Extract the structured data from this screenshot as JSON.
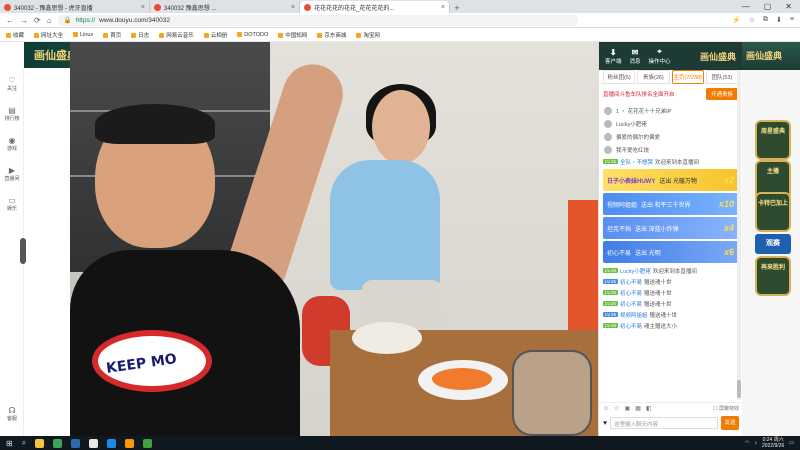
{
  "browser": {
    "tabs": [
      {
        "title": "340032 - 豫鑫思想 - 虎牙直播"
      },
      {
        "title": "340032 豫鑫思想 ..."
      },
      {
        "title": "花花花花的花花_花花花花的..."
      }
    ],
    "url_scheme": "https://",
    "url_host": "www.douyu.com/340032",
    "bookmarks": [
      "收藏",
      "网址大全",
      "Linux",
      "首页",
      "日志",
      "网易云音乐",
      "云相册",
      "DOTODO",
      "中国知网",
      "京东商城",
      "淘宝网"
    ]
  },
  "left_rail": {
    "items": [
      {
        "label": "关注",
        "icon": "heart-icon"
      },
      {
        "label": "排行榜",
        "icon": "chart-icon"
      },
      {
        "label": "游戏",
        "icon": "game-icon"
      },
      {
        "label": "直播间",
        "icon": "live-icon"
      },
      {
        "label": "娱乐",
        "icon": "tv-icon"
      },
      {
        "label": "客服",
        "icon": "headset-icon"
      }
    ]
  },
  "stream_header": {
    "logo": "画仙盛典",
    "right_items": [
      {
        "label": "客户端",
        "icon": "download-icon"
      },
      {
        "label": "消息",
        "icon": "bell-icon"
      },
      {
        "label": "操作中心",
        "icon": "pin-icon"
      }
    ],
    "right_logo": "画仙盛典"
  },
  "video": {
    "shirt_text": "KEEP MO"
  },
  "chat": {
    "tabs": [
      "粉丝团(5)",
      "贵族(26)",
      "主页(7/238)",
      "团队(53)"
    ],
    "active_tab": 2,
    "notice_text": "直播间斗鱼车队排名全面开启",
    "notice_button": "开通贵族",
    "rank": [
      "1 ・ 花花花十十兄弟IP",
      "Lucky小肥佬",
      "偏爱的偶尔的偏爱",
      "我不爱吃红烧"
    ],
    "messages": [
      {
        "lv": "LV.25",
        "nick": "全队・不想哭",
        "text": "欢迎来到本直播间"
      }
    ],
    "gifts": [
      {
        "title": "日子小表妹HUWY",
        "sub": "送出 光暖万物",
        "count": "x2"
      },
      {
        "title": "视频阿姐姐",
        "sub": "送出 和平三千世界",
        "count": "x10"
      },
      {
        "title": "坦克不挡",
        "sub": "送出 深蓝小炸弹",
        "count": "x4"
      },
      {
        "title": "初心不易",
        "sub": "送出 光明",
        "count": "x6"
      }
    ],
    "messages2": [
      {
        "lv": "LV.26",
        "nick": "Lucky小肥佬",
        "text": "欢迎来到本直播间"
      },
      {
        "lv": "LV.26",
        "nick": "初心不易",
        "text": "赠送魂十世"
      },
      {
        "lv": "LV.26",
        "nick": "初心不易",
        "text": "赠送魂十世"
      },
      {
        "lv": "LV.26",
        "nick": "初心不易",
        "text": "赠送魂十世"
      },
      {
        "lv": "LV.26",
        "nick": "视频阿姐姐",
        "text": "赠送魂十世"
      },
      {
        "lv": "LV.26",
        "nick": "初心不易",
        "text": "魂主赠送大小"
      }
    ],
    "input_placeholder": "这里输入聊天内容",
    "send_label": "发送",
    "checkbox_label": "屏蔽特效"
  },
  "far_right": {
    "badges": [
      "周星盛典",
      "主播",
      "卡特巴加上"
    ],
    "blue_badge": "观赛",
    "bottom_badge": "再来胜利"
  },
  "taskbar": {
    "time": "0:24 周六",
    "date": "2022/9/26"
  },
  "colors": {
    "accent": "#f27b00",
    "header": "#1d3a34",
    "gold": "#f3d27a"
  }
}
